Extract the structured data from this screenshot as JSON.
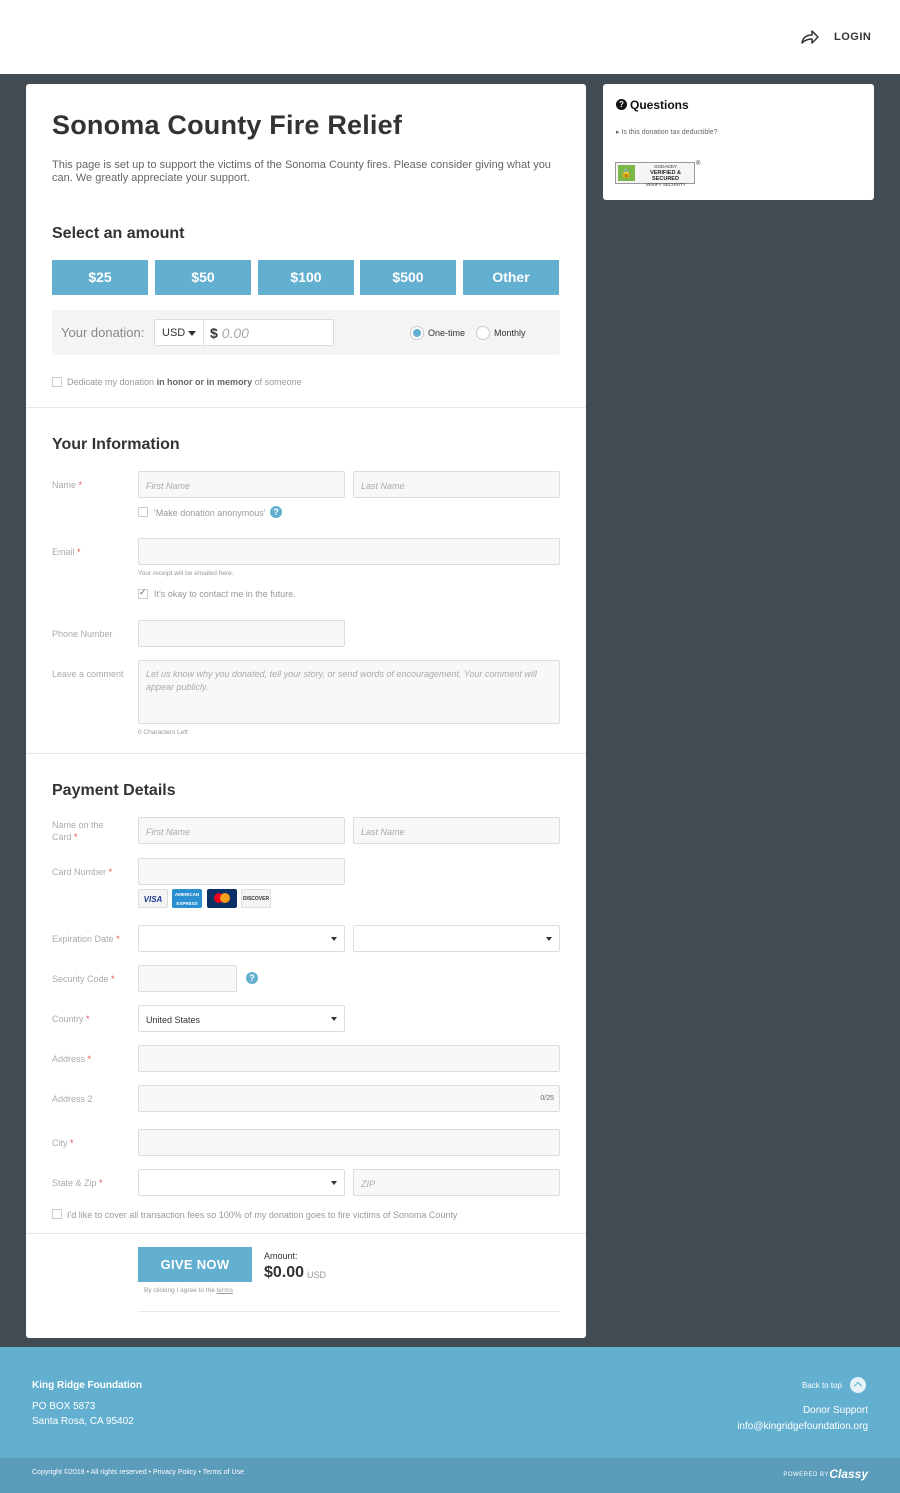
{
  "header": {
    "login_label": "LOGIN"
  },
  "campaign": {
    "title": "Sonoma County Fire Relief",
    "intro": "This page is set up to support the victims of the Sonoma County fires. Please consider giving what you can.  We greatly appreciate your support."
  },
  "amount": {
    "heading": "Select an amount",
    "options": [
      "$25",
      "$50",
      "$100",
      "$500",
      "Other"
    ],
    "donation_label": "Your donation:",
    "currency": "USD",
    "symbol": "$",
    "placeholder": "0.00",
    "freq_onetime": "One-time",
    "freq_monthly": "Monthly",
    "selected_frequency": "One-time",
    "dedicate_prefix": "Dedicate my donation ",
    "dedicate_bold": "in honor or in memory",
    "dedicate_suffix": " of someone"
  },
  "info": {
    "heading": "Your Information",
    "name_label": "Name",
    "first_placeholder": "First Name",
    "last_placeholder": "Last Name",
    "anonymous_label": "'Make donation anonymous'",
    "email_label": "Email",
    "email_hint": "Your receipt will be emailed here.",
    "contact_label": "It's okay to contact me in the future.",
    "phone_label": "Phone Number",
    "comment_label": "Leave a comment",
    "comment_placeholder": "Let us know why you donated, tell your story, or send words of encouragement. Your comment will appear publicly.",
    "chars_left": "0 Characters Left"
  },
  "payment": {
    "heading": "Payment Details",
    "name_label_1": "Name on the",
    "name_label_2": "Card",
    "first_placeholder": "First Name",
    "last_placeholder": "Last Name",
    "card_label": "Card Number",
    "cards": {
      "visa": "VISA",
      "amex": "AMERICAN EXPRESS",
      "discover": "DISCOVER"
    },
    "expiry_label": "Expiration Date",
    "security_label": "Security Code",
    "country_label": "Country",
    "country_value": "United States",
    "address_label": "Address",
    "address2_label": "Address 2",
    "address2_counter": "0/25",
    "city_label": "City",
    "state_zip_label": "State & Zip",
    "zip_placeholder": "ZIP",
    "cover_fees_label": "I'd like to cover all transaction fees so 100% of my donation goes to fire victims of Sonoma County"
  },
  "submit": {
    "button": "GIVE NOW",
    "amount_label": "Amount:",
    "amount_value": "$0.00",
    "amount_currency": "USD",
    "terms_prefix": "By clicking I agree to the ",
    "terms_link": "terms"
  },
  "sidebar": {
    "questions_title": "Questions",
    "question_link": "Is this donation tax deductible?",
    "badge_top": "GODADDY",
    "badge_main": "VERIFIED & SECURED",
    "badge_bottom": "VERIFY SECURITY"
  },
  "footer": {
    "org": "King Ridge Foundation",
    "address1": "PO BOX 5873",
    "address2": "Santa Rosa, CA 95402",
    "back_to_top": "Back to top",
    "support": "Donor Support",
    "email": "info@kingridgefoundation.org",
    "copyright": "Copyright ©2018 • All rights reserved • ",
    "privacy": "Privacy Policy",
    "terms": "Terms of Use",
    "powered_by": "POWERED BY",
    "brand": "Classy"
  },
  "colors": {
    "accent": "#62afd0",
    "background": "#424a52",
    "footer": "#62afd0",
    "footer_bottom": "#5a9cba"
  }
}
